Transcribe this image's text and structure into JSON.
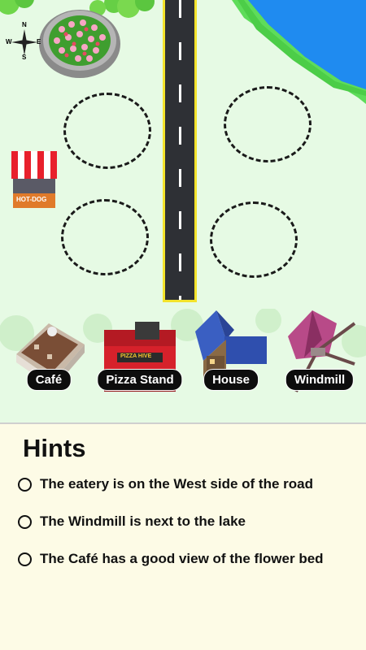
{
  "compass": {
    "n": "N",
    "s": "S",
    "e": "E",
    "w": "W"
  },
  "map": {
    "hotdog_sign": "HOT-DOG",
    "plots": [
      "plot-nw",
      "plot-ne",
      "plot-sw",
      "plot-se"
    ]
  },
  "cards": [
    {
      "id": "cafe",
      "label": "Café",
      "icon": "cafe-building-icon"
    },
    {
      "id": "pizza",
      "label": "Pizza Stand",
      "icon": "pizza-stand-icon",
      "sign": "PIZZA HIVE"
    },
    {
      "id": "house",
      "label": "House",
      "icon": "house-icon"
    },
    {
      "id": "windmill",
      "label": "Windmill",
      "icon": "windmill-icon"
    }
  ],
  "hints": {
    "title": "Hints",
    "items": [
      "The eatery is on the West side of the road",
      "The Windmill is next to the lake",
      "The Café has a good view of the flower bed"
    ]
  },
  "colors": {
    "grass": "#e6fae4",
    "lake": "#1f8bf0",
    "road": "#2e3035",
    "road_edge": "#f3e32b",
    "panel": "#fdfbe6"
  }
}
